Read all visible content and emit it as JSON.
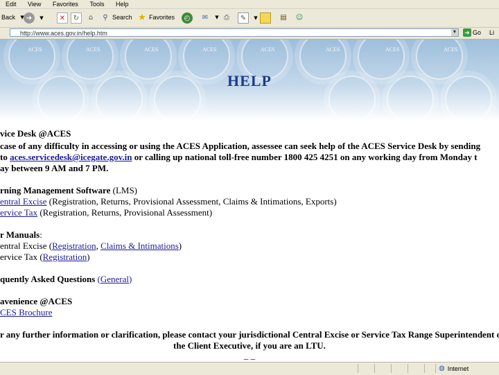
{
  "menu": {
    "items": [
      "Edit",
      "View",
      "Favorites",
      "Tools",
      "Help"
    ]
  },
  "toolbar": {
    "back_label": "Back",
    "search_label": "Search",
    "favorites_label": "Favorites"
  },
  "address": {
    "url": "http://www.aces.gov.in/help.htm",
    "go_label": "Go",
    "links_label": "Li"
  },
  "banner": {
    "emblem_label": "ACES",
    "title": "HELP"
  },
  "content": {
    "service_desk_heading": "vice Desk @ACES",
    "service_desk_line1": "case of any difficulty in accessing or using the ACES Application, assessee can seek help of the ACES Service Desk by sending",
    "service_desk_line2_pre": "to ",
    "service_desk_email": "aces.servicedesk@icegate.gov.in",
    "service_desk_line2_post": " or calling up national toll-free number 1800 425 4251 on any working day from Monday t",
    "service_desk_line3": "ay between 9 AM and 7 PM.",
    "lms_heading_bold": "rning Management Software",
    "lms_heading_rest": " (LMS)",
    "lms_ce_link": "entral Excise",
    "lms_ce_rest": " (Registration, Returns, Provisional Assessment, Claims & Intimations, Exports)",
    "lms_st_link": "ervice Tax",
    "lms_st_rest": " (Registration, Returns, Provisional Assessment)",
    "manuals_heading_bold": "r Manuals",
    "manuals_heading_rest": ":",
    "manuals_ce_pre": "entral Excise (",
    "manuals_ce_link1": "Registration",
    "manuals_ce_sep": ", ",
    "manuals_ce_link2": "Claims & Intimations",
    "manuals_ce_post": ")",
    "manuals_st_pre": "ervice Tax (",
    "manuals_st_link": "Registration",
    "manuals_st_post": ")",
    "faq_heading_bold": "quently Asked Questions",
    "faq_link_pre": " (",
    "faq_link": "General",
    "faq_link_post": ")",
    "convenience_heading": "avenience @ACES",
    "brochure_link": "CES Brochure",
    "footer_line1": "r any further information or clarification, please contact your jurisdictional Central Excise or Service Tax Range Superintendent o",
    "footer_line2": "the Client Executive, if you are an LTU.",
    "footer_dashes": "_ _"
  },
  "status": {
    "zone_label": "Internet"
  }
}
